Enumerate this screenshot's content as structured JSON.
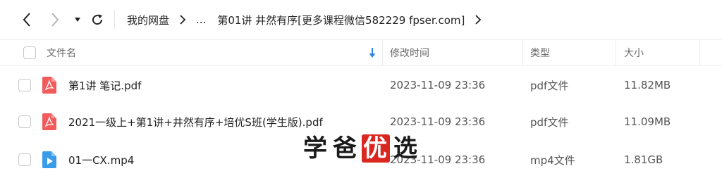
{
  "breadcrumb": {
    "root": "我的网盘",
    "ellipsis": "...",
    "current": "第01讲 井然有序[更多课程微信582229 fpser.com]"
  },
  "columns": {
    "name": "文件名",
    "modified": "修改时间",
    "type": "类型",
    "size": "大小"
  },
  "files": [
    {
      "name": "第1讲 笔记.pdf",
      "modified": "2023-11-09 23:36",
      "type": "pdf文件",
      "size": "11.82MB",
      "icon": "pdf-icon"
    },
    {
      "name": "2021一级上+第1讲+井然有序+培优S班(学生版).pdf",
      "modified": "2023-11-09 23:36",
      "type": "pdf文件",
      "size": "11.09MB",
      "icon": "pdf-icon"
    },
    {
      "name": "01一CX.mp4",
      "modified": "2023-11-09 23:36",
      "type": "mp4文件",
      "size": "1.81GB",
      "icon": "video-icon"
    }
  ],
  "watermark": {
    "char1": "学",
    "char2": "爸",
    "char3": "优",
    "char4": "选"
  },
  "colors": {
    "pdf_icon": "#f25b5b",
    "video_icon": "#3a9be8",
    "sort_icon": "#2f86e0",
    "watermark_box": "#d9271f"
  }
}
